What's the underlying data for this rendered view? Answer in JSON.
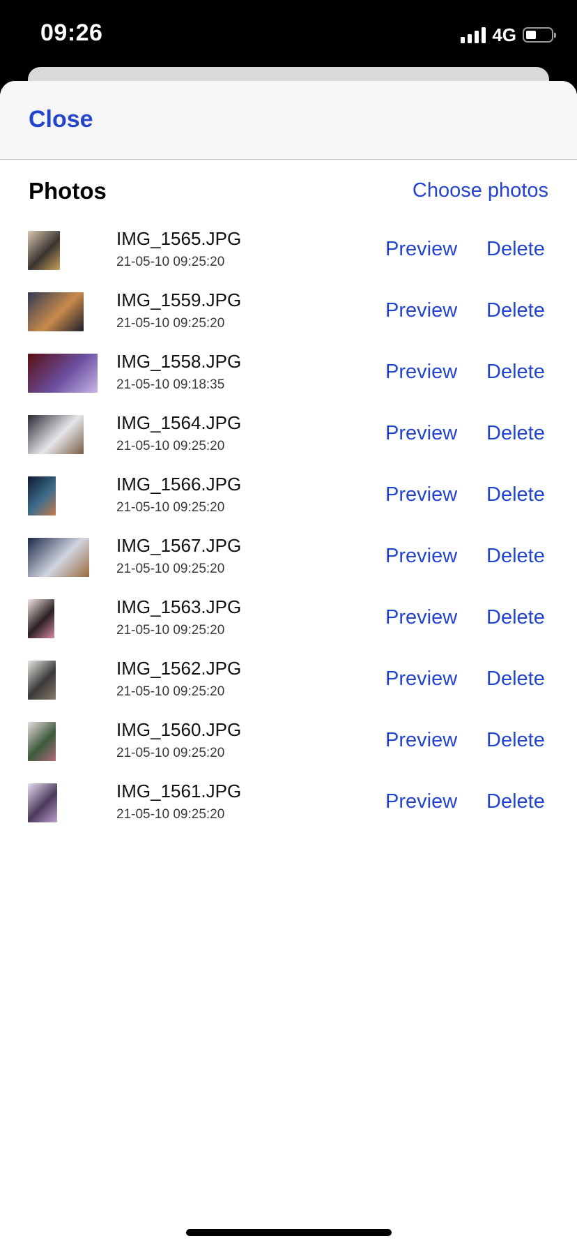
{
  "status_bar": {
    "time": "09:26",
    "network": "4G",
    "icons": [
      "signal-icon",
      "battery-icon"
    ]
  },
  "header": {
    "close_label": "Close"
  },
  "section": {
    "title": "Photos",
    "choose_label": "Choose photos"
  },
  "colors": {
    "accent": "#2344cc",
    "header_bg": "#f6f6f6",
    "text": "#111111"
  },
  "photos": [
    {
      "name": "IMG_1565.JPG",
      "time": "21-05-10 09:25:20",
      "preview": "Preview",
      "delete": "Delete",
      "thumb_colors": [
        "#d8c9b0",
        "#3a3330",
        "#c9a15a"
      ]
    },
    {
      "name": "IMG_1559.JPG",
      "time": "21-05-10 09:25:20",
      "preview": "Preview",
      "delete": "Delete",
      "thumb_colors": [
        "#2e3b55",
        "#c98a4a",
        "#1b1f2c"
      ]
    },
    {
      "name": "IMG_1558.JPG",
      "time": "21-05-10 09:18:35",
      "preview": "Preview",
      "delete": "Delete",
      "thumb_colors": [
        "#5a0f12",
        "#6a4fa0",
        "#c9b6e6"
      ]
    },
    {
      "name": "IMG_1564.JPG",
      "time": "21-05-10 09:25:20",
      "preview": "Preview",
      "delete": "Delete",
      "thumb_colors": [
        "#2a2a33",
        "#e6e6ea",
        "#7a5c44"
      ]
    },
    {
      "name": "IMG_1566.JPG",
      "time": "21-05-10 09:25:20",
      "preview": "Preview",
      "delete": "Delete",
      "thumb_colors": [
        "#0f1830",
        "#3c6d8a",
        "#c77a4a"
      ]
    },
    {
      "name": "IMG_1567.JPG",
      "time": "21-05-10 09:25:20",
      "preview": "Preview",
      "delete": "Delete",
      "thumb_colors": [
        "#1e2a4a",
        "#d0d4e0",
        "#9a6a3a"
      ]
    },
    {
      "name": "IMG_1563.JPG",
      "time": "21-05-10 09:25:20",
      "preview": "Preview",
      "delete": "Delete",
      "thumb_colors": [
        "#f1e3e0",
        "#2a1f22",
        "#d98aa0"
      ]
    },
    {
      "name": "IMG_1562.JPG",
      "time": "21-05-10 09:25:20",
      "preview": "Preview",
      "delete": "Delete",
      "thumb_colors": [
        "#e9e6e0",
        "#3a3a3a",
        "#8a7a6a"
      ]
    },
    {
      "name": "IMG_1560.JPG",
      "time": "21-05-10 09:25:20",
      "preview": "Preview",
      "delete": "Delete",
      "thumb_colors": [
        "#eadbe0",
        "#3a5a3a",
        "#b06a7a"
      ]
    },
    {
      "name": "IMG_1561.JPG",
      "time": "21-05-10 09:25:20",
      "preview": "Preview",
      "delete": "Delete",
      "thumb_colors": [
        "#e8dcef",
        "#4a3a5a",
        "#c0a0d0"
      ]
    }
  ]
}
